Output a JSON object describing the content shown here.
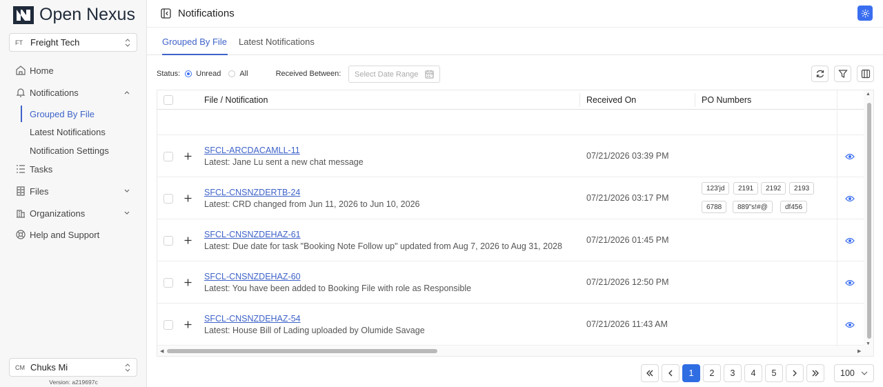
{
  "app": {
    "name": "Open Nexus",
    "version": "Version: a219697c"
  },
  "org": {
    "abbr": "FT",
    "name": "Freight Tech"
  },
  "user": {
    "abbr": "CM",
    "name": "Chuks Mi"
  },
  "nav": {
    "home": "Home",
    "notifications": "Notifications",
    "sub": [
      "Grouped By File",
      "Latest Notifications",
      "Notification Settings"
    ],
    "tasks": "Tasks",
    "files": "Files",
    "organizations": "Organizations",
    "help": "Help and Support"
  },
  "header": {
    "title": "Notifications"
  },
  "tabs": [
    "Grouped By File",
    "Latest Notifications"
  ],
  "filters": {
    "status_label": "Status:",
    "unread": "Unread",
    "all": "All",
    "received_between": "Received Between:",
    "date_placeholder": "Select Date Range"
  },
  "table": {
    "headers": [
      "File / Notification",
      "Received On",
      "PO Numbers"
    ],
    "rows": [
      {
        "file": "SFCL-ARCDACAMLL-11",
        "latest": "Latest: Jane Lu sent a new chat message",
        "received": "07/21/2026 03:39 PM",
        "po": []
      },
      {
        "file": "SFCL-CNSNZDERTB-24",
        "latest": "Latest: CRD changed from Jun 11, 2026 to Jun 10, 2026",
        "received": "07/21/2026 03:17 PM",
        "po": [
          "123'jd",
          "2191",
          "2192",
          "2193",
          "6788",
          "889\"s!#@",
          "df456"
        ]
      },
      {
        "file": "SFCL-CNSNZDEHAZ-61",
        "latest": "Latest: Due date for task \"Booking Note Follow up\" updated from Aug 7, 2026 to Aug 31, 2028",
        "received": "07/21/2026 01:45 PM",
        "po": []
      },
      {
        "file": "SFCL-CNSNZDEHAZ-60",
        "latest": "Latest: You have been added to Booking File with role as Responsible",
        "received": "07/21/2026 12:50 PM",
        "po": []
      },
      {
        "file": "SFCL-CNSNZDEHAZ-54",
        "latest": "Latest: House Bill of Lading uploaded by Olumide Savage",
        "received": "07/21/2026 11:43 AM",
        "po": []
      }
    ]
  },
  "pagination": {
    "pages": [
      "1",
      "2",
      "3",
      "4",
      "5"
    ],
    "current": 1,
    "page_size": "100"
  },
  "colors": {
    "accent": "#3e63c9",
    "primary_button": "#2f6de3"
  }
}
